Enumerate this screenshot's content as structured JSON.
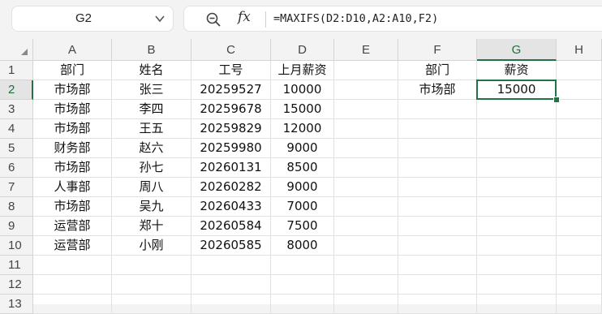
{
  "namebox": {
    "ref": "G2"
  },
  "formula_bar": {
    "fx_label": "fx",
    "formula": "=MAXIFS(D2:D10,A2:A10,F2)"
  },
  "columns": [
    "A",
    "B",
    "C",
    "D",
    "E",
    "F",
    "G",
    "H"
  ],
  "rows": [
    "1",
    "2",
    "3",
    "4",
    "5",
    "6",
    "7",
    "8",
    "9",
    "10",
    "11",
    "12",
    "13"
  ],
  "selected": {
    "col": "G",
    "row": "2"
  },
  "cells": [
    [
      "部门",
      "姓名",
      "工号",
      "上月薪资",
      "",
      "部门",
      "薪资",
      ""
    ],
    [
      "市场部",
      "张三",
      "20259527",
      "10000",
      "",
      "市场部",
      "15000",
      ""
    ],
    [
      "市场部",
      "李四",
      "20259678",
      "15000",
      "",
      "",
      "",
      ""
    ],
    [
      "市场部",
      "王五",
      "20259829",
      "12000",
      "",
      "",
      "",
      ""
    ],
    [
      "财务部",
      "赵六",
      "20259980",
      "9000",
      "",
      "",
      "",
      ""
    ],
    [
      "市场部",
      "孙七",
      "20260131",
      "8500",
      "",
      "",
      "",
      ""
    ],
    [
      "人事部",
      "周八",
      "20260282",
      "9000",
      "",
      "",
      "",
      ""
    ],
    [
      "市场部",
      "吴九",
      "20260433",
      "7000",
      "",
      "",
      "",
      ""
    ],
    [
      "运营部",
      "郑十",
      "20260584",
      "7500",
      "",
      "",
      "",
      ""
    ],
    [
      "运营部",
      "小刚",
      "20260585",
      "8000",
      "",
      "",
      "",
      ""
    ],
    [
      "",
      "",
      "",
      "",
      "",
      "",
      "",
      ""
    ],
    [
      "",
      "",
      "",
      "",
      "",
      "",
      "",
      ""
    ],
    [
      "",
      "",
      "",
      "",
      "",
      "",
      "",
      ""
    ]
  ],
  "icons": {
    "namebox_dropdown": "chevron-down-icon",
    "zoom": "zoom-icon",
    "select_all": "select-all-icon"
  },
  "colors": {
    "accent": "#217346"
  }
}
